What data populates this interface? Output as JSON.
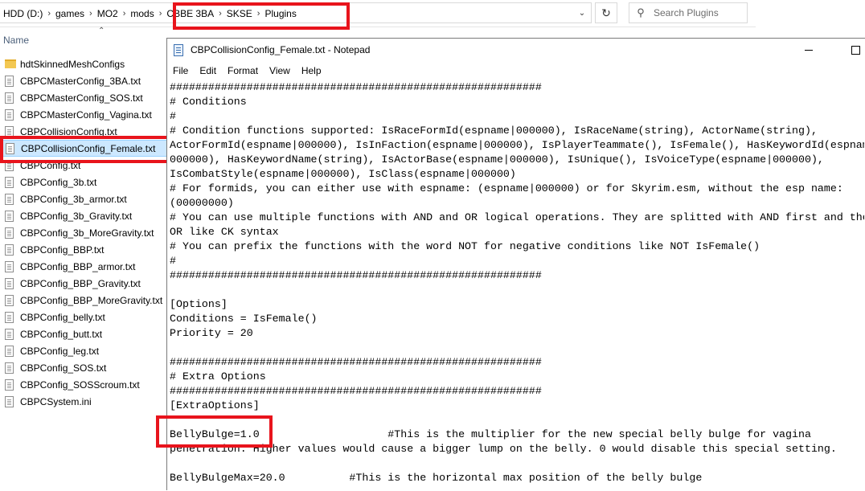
{
  "explorer": {
    "breadcrumbs": [
      "HDD (D:)",
      "games",
      "MO2",
      "mods",
      "CBBE 3BA",
      "SKSE",
      "Plugins"
    ],
    "search_placeholder": "Search Plugins",
    "column_header": "Name",
    "files": [
      {
        "name": "hdtSkinnedMeshConfigs",
        "type": "folder"
      },
      {
        "name": "CBPCMasterConfig_3BA.txt",
        "type": "file"
      },
      {
        "name": "CBPCMasterConfig_SOS.txt",
        "type": "file"
      },
      {
        "name": "CBPCMasterConfig_Vagina.txt",
        "type": "file"
      },
      {
        "name": "CBPCollisionConfig.txt",
        "type": "file"
      },
      {
        "name": "CBPCollisionConfig_Female.txt",
        "type": "file",
        "selected": true
      },
      {
        "name": "CBPConfig.txt",
        "type": "file"
      },
      {
        "name": "CBPConfig_3b.txt",
        "type": "file"
      },
      {
        "name": "CBPConfig_3b_armor.txt",
        "type": "file"
      },
      {
        "name": "CBPConfig_3b_Gravity.txt",
        "type": "file"
      },
      {
        "name": "CBPConfig_3b_MoreGravity.txt",
        "type": "file"
      },
      {
        "name": "CBPConfig_BBP.txt",
        "type": "file"
      },
      {
        "name": "CBPConfig_BBP_armor.txt",
        "type": "file"
      },
      {
        "name": "CBPConfig_BBP_Gravity.txt",
        "type": "file"
      },
      {
        "name": "CBPConfig_BBP_MoreGravity.txt",
        "type": "file"
      },
      {
        "name": "CBPConfig_belly.txt",
        "type": "file"
      },
      {
        "name": "CBPConfig_butt.txt",
        "type": "file"
      },
      {
        "name": "CBPConfig_leg.txt",
        "type": "file"
      },
      {
        "name": "CBPConfig_SOS.txt",
        "type": "file"
      },
      {
        "name": "CBPConfig_SOSScroum.txt",
        "type": "file"
      },
      {
        "name": "CBPCSystem.ini",
        "type": "file"
      }
    ]
  },
  "notepad": {
    "title": "CBPCollisionConfig_Female.txt - Notepad",
    "menu": [
      "File",
      "Edit",
      "Format",
      "View",
      "Help"
    ],
    "lines": [
      "##########################################################",
      "# Conditions",
      "#",
      "# Condition functions supported: IsRaceFormId(espname|000000), IsRaceName(string), ActorName(string),",
      "ActorFormId(espname|000000), IsInFaction(espname|000000), IsPlayerTeammate(), IsFemale(), HasKeywordId(espname|",
      "000000), HasKeywordName(string), IsActorBase(espname|000000), IsUnique(), IsVoiceType(espname|000000),",
      "IsCombatStyle(espname|000000), IsClass(espname|000000)",
      "# For formids, you can either use with espname: (espname|000000) or for Skyrim.esm, without the esp name:",
      "(00000000)",
      "# You can use multiple functions with AND and OR logical operations. They are splitted with AND first and then",
      "OR like CK syntax",
      "# You can prefix the functions with the word NOT for negative conditions like NOT IsFemale()",
      "#",
      "##########################################################",
      "",
      "[Options]",
      "Conditions = IsFemale()",
      "Priority = 20",
      "",
      "##########################################################",
      "# Extra Options",
      "##########################################################",
      "[ExtraOptions]",
      "",
      "BellyBulge=1.0                    #This is the multiplier for the new special belly bulge for vagina",
      "penetration. Higher values would cause a bigger lump on the belly. 0 would disable this special setting.",
      "",
      "BellyBulgeMax=20.0          #This is the horizontal max position of the belly bulge"
    ]
  },
  "colors": {
    "highlight_box": "#e8141c",
    "selection_bg": "#cce8ff",
    "selection_border": "#99d1ff"
  }
}
